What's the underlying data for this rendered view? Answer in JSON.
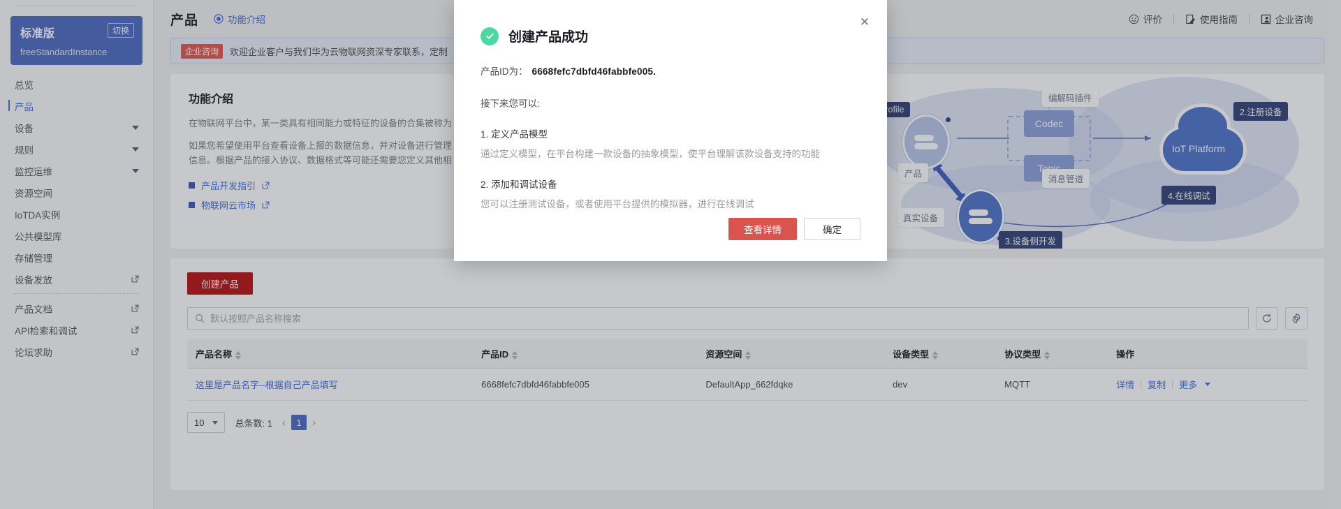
{
  "sidebar": {
    "instance": {
      "edition": "标准版",
      "switch_label": "切换",
      "instance_name": "freeStandardInstance"
    },
    "items": [
      {
        "label": "总览",
        "type": "plain",
        "active": false
      },
      {
        "label": "产品",
        "type": "plain",
        "active": true
      },
      {
        "label": "设备",
        "type": "expand",
        "active": false
      },
      {
        "label": "规则",
        "type": "expand",
        "active": false
      },
      {
        "label": "监控运维",
        "type": "expand",
        "active": false
      },
      {
        "label": "资源空间",
        "type": "plain",
        "active": false
      },
      {
        "label": "IoTDA实例",
        "type": "plain",
        "active": false
      },
      {
        "label": "公共模型库",
        "type": "plain",
        "active": false
      },
      {
        "label": "存储管理",
        "type": "plain",
        "active": false
      },
      {
        "label": "设备发放",
        "type": "external",
        "active": false
      },
      {
        "label": "产品文档",
        "type": "external",
        "active": false
      },
      {
        "label": "API检索和调试",
        "type": "external",
        "active": false
      },
      {
        "label": "论坛求助",
        "type": "external",
        "active": false
      }
    ]
  },
  "topbar": {
    "title": "产品",
    "feature_link": "功能介绍",
    "right_items": [
      {
        "label": "评价",
        "icon": "smiley-icon"
      },
      {
        "label": "使用指南",
        "icon": "guide-icon"
      },
      {
        "label": "企业咨询",
        "icon": "consult-icon"
      }
    ]
  },
  "banner": {
    "tag": "企业咨询",
    "text": "欢迎企业客户与我们华为云物联网资深专家联系，定制"
  },
  "intro": {
    "heading": "功能介绍",
    "paragraph1": "在物联网平台中，某一类具有相同能力或特征的设备的合集被称为",
    "paragraph2_line1": "如果您希望使用平台查看设备上报的数据信息，并对设备进行管理",
    "paragraph2_line2": "信息。根据产品的接入协议、数据格式等可能还需要您定义其他相",
    "links": [
      {
        "label": "产品开发指引"
      },
      {
        "label": "物联网云市场"
      }
    ]
  },
  "diagram": {
    "labels": {
      "profile": "Profile",
      "codec_box": "Codec",
      "topic_box": "Topic",
      "codec_note": "编解码插件",
      "topic_note": "消息管道",
      "product": "产品",
      "real_device": "真实设备",
      "platform": "IoT Platform",
      "step2": "2.注册设备",
      "step3": "3.设备侧开发",
      "step4": "4.在线调试"
    }
  },
  "list": {
    "create_button": "创建产品",
    "search_placeholder": "默认按照产品名称搜索",
    "search_value": "",
    "refresh_icon": "refresh-icon",
    "settings_icon": "gear-icon",
    "columns": [
      {
        "label": "产品名称",
        "sortable": true
      },
      {
        "label": "产品ID",
        "sortable": true
      },
      {
        "label": "资源空间",
        "sortable": true
      },
      {
        "label": "设备类型",
        "sortable": true
      },
      {
        "label": "协议类型",
        "sortable": true
      },
      {
        "label": "操作",
        "sortable": false
      }
    ],
    "rows": [
      {
        "name": "这里是产品名字--根据自己产品填写",
        "product_id": "6668fefc7dbfd46fabbfe005",
        "resource_space": "DefaultApp_662fdqke",
        "device_type": "dev",
        "protocol": "MQTT",
        "ops": [
          "详情",
          "复制",
          "更多"
        ]
      }
    ],
    "pager": {
      "page_size": "10",
      "total_label": "总条数: 1",
      "current_page": "1"
    }
  },
  "modal": {
    "title": "创建产品成功",
    "close_icon": "close-icon",
    "product_id_label": "产品ID为：",
    "product_id": "6668fefc7dbfd46fabbfe005.",
    "next_label": "接下来您可以:",
    "steps": [
      {
        "heading": "1. 定义产品模型",
        "desc": "通过定义模型，在平台构建一款设备的抽象模型，使平台理解该款设备支持的功能"
      },
      {
        "heading": "2. 添加和调试设备",
        "desc": "您可以注册测试设备，或者使用平台提供的模拟器，进行在线调试"
      }
    ],
    "primary_button": "查看详情",
    "default_button": "确定"
  },
  "colors": {
    "accent_blue": "#4a6ac0",
    "link_blue": "#3b6ce0",
    "create_red": "#b70d0d",
    "modal_primary_red": "#d9534f",
    "success_green": "#4cd8a0",
    "tag_red": "#e6544a"
  }
}
